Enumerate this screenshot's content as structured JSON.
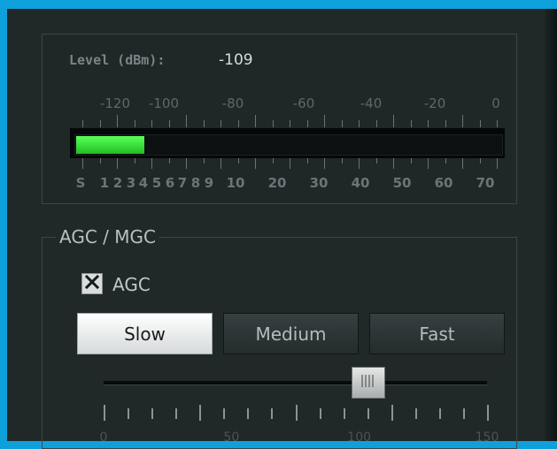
{
  "level": {
    "label": "Level (dBm):",
    "value": "-109",
    "value_dbm": -109,
    "scale_dbm": [
      "-120",
      "-100",
      "-80",
      "-60",
      "-40",
      "-20",
      "0"
    ],
    "scale_s": [
      "S",
      "1",
      "2",
      "3",
      "4",
      "5",
      "6",
      "7",
      "8",
      "9",
      "10",
      "20",
      "30",
      "40",
      "50",
      "60",
      "70"
    ],
    "meter_fraction": 0.16,
    "meter_color": "#3ddc3d"
  },
  "agc": {
    "group_title": "AGC / MGC",
    "checkbox_label": "AGC",
    "checkbox_checked": true,
    "checkbox_mark": "✕",
    "buttons": [
      "Slow",
      "Medium",
      "Fast"
    ],
    "selected": "Slow",
    "slider_fraction": 0.69,
    "slider_scale": [
      "0",
      "50",
      "100",
      "150"
    ]
  },
  "colors": {
    "frame": "#0ea0db",
    "background": "#202828",
    "meter_green": "#3ddc3d"
  }
}
